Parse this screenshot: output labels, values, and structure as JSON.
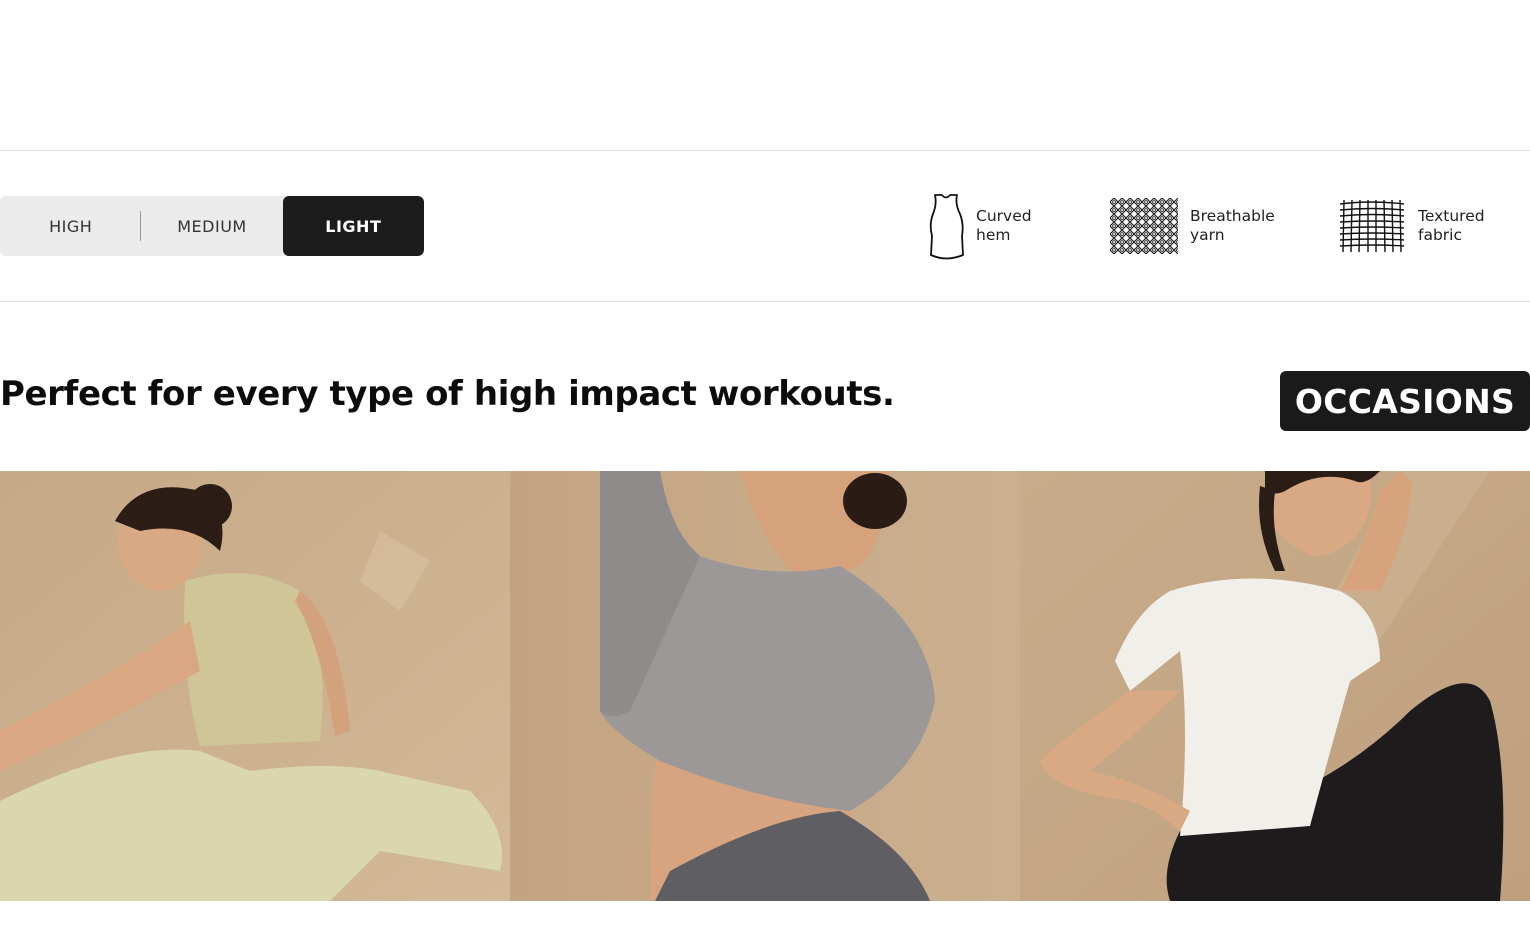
{
  "intensity": {
    "options": [
      "HIGH",
      "MEDIUM",
      "LIGHT"
    ],
    "selected": "LIGHT"
  },
  "features": [
    {
      "icon": "tank-top-icon",
      "line1": "Curved",
      "line2": "hem"
    },
    {
      "icon": "mesh-icon",
      "line1": "Breathable",
      "line2": "yarn"
    },
    {
      "icon": "grid-fabric-icon",
      "line1": "Textured",
      "line2": "fabric"
    }
  ],
  "headline": "Perfect for every type of high impact workouts.",
  "badge": "OCCASIONS",
  "photos": [
    {
      "subject": "woman stretching in sage tank top and leggings"
    },
    {
      "subject": "woman in grey cropped long-sleeve tee"
    },
    {
      "subject": "woman in white short-sleeve tee and black pants"
    }
  ],
  "colors": {
    "accent_dark": "#1c1c1c",
    "segment_bg": "#ebebeb",
    "photo_bg": "#c9ad8c"
  }
}
